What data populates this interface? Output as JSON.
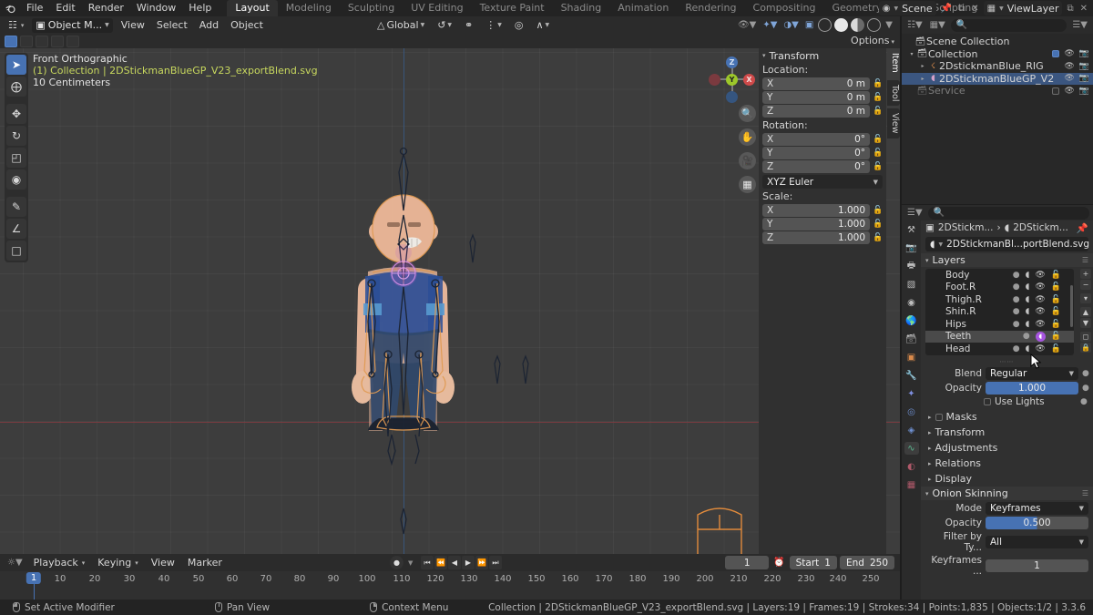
{
  "app": {
    "name": "Blender",
    "version": "3.3.6"
  },
  "topbar": {
    "logo_icon": "blender-logo-icon",
    "menus": [
      "File",
      "Edit",
      "Render",
      "Window",
      "Help"
    ],
    "workspaces": [
      {
        "label": "Layout",
        "active": true
      },
      {
        "label": "Modeling",
        "active": false
      },
      {
        "label": "Sculpting",
        "active": false
      },
      {
        "label": "UV Editing",
        "active": false
      },
      {
        "label": "Texture Paint",
        "active": false
      },
      {
        "label": "Shading",
        "active": false
      },
      {
        "label": "Animation",
        "active": false
      },
      {
        "label": "Rendering",
        "active": false
      },
      {
        "label": "Compositing",
        "active": false
      },
      {
        "label": "Geometry Nodes",
        "active": false
      },
      {
        "label": "Scripting",
        "active": false
      }
    ],
    "add_workspace_label": "+",
    "scene": {
      "icon": "scene-icon",
      "name": "Scene",
      "pin_icon": "pin-icon",
      "new_icon": "new-copy-icon",
      "unlink_icon": "x-icon"
    },
    "viewlayer": {
      "icon": "viewlayer-icon",
      "name": "ViewLayer",
      "new_icon": "new-copy-icon",
      "unlink_icon": "x-icon"
    }
  },
  "viewport_header": {
    "editor_type_icon": "editor-type-icon",
    "mode": "Object M...",
    "menus": [
      "View",
      "Select",
      "Add",
      "Object"
    ],
    "transform_orientation": "Global",
    "pivot_icon": "pivot-icon",
    "snap_icon": "magnet-icon",
    "snap_target_icon": "snap-increment-icon",
    "proportional_icon": "proportional-editing-icon",
    "falloff_icon": "smooth-falloff-icon",
    "right_icons": [
      "visibility-icon",
      "gizmo-icon",
      "overlays-icon",
      "xray-icon",
      "shading-wireframe-icon",
      "shading-solid-icon",
      "shading-material-icon",
      "shading-rendered-icon"
    ],
    "options_label": "Options"
  },
  "viewport": {
    "view_name": "Front Orthographic",
    "collection_line": "(1) Collection | 2DStickmanBlueGP_V23_exportBlend.svg",
    "grid_scale": "10 Centimeters",
    "gizmo_axes": [
      {
        "label": "Z",
        "color": "#4772b3"
      },
      {
        "label": "Y",
        "color": "#9dc82a"
      },
      {
        "label": "X",
        "color": "#cf4a4a"
      }
    ],
    "nav_icons": [
      "zoom-icon",
      "pan-hand-icon",
      "camera-icon",
      "orthographic-grid-icon"
    ],
    "tools": [
      {
        "name": "tweak-select-tool",
        "glyph": "➤",
        "active": true
      },
      {
        "name": "cursor-tool",
        "glyph": "⊕",
        "active": false
      },
      {
        "name": "move-tool",
        "glyph": "✥",
        "active": false
      },
      {
        "name": "rotate-tool",
        "glyph": "↻",
        "active": false
      },
      {
        "name": "scale-tool",
        "glyph": "◰",
        "active": false
      },
      {
        "name": "transform-tool",
        "glyph": "◉",
        "active": false
      },
      {
        "name": "annotate-tool",
        "glyph": "✎",
        "active": false
      },
      {
        "name": "measure-tool",
        "glyph": "∠",
        "active": false
      },
      {
        "name": "add-cube-tool",
        "glyph": "□",
        "active": false
      }
    ],
    "select_modes": [
      "set-select-mode",
      "extend-select-mode",
      "subtract-select-mode",
      "invert-select-mode",
      "intersect-select-mode"
    ]
  },
  "sidebar_n": {
    "tabs": [
      {
        "label": "Item",
        "active": true
      },
      {
        "label": "Tool",
        "active": false
      },
      {
        "label": "View",
        "active": false
      }
    ],
    "panel_title": "Transform",
    "location_label": "Location:",
    "location": [
      {
        "axis": "X",
        "value": "0 m"
      },
      {
        "axis": "Y",
        "value": "0 m"
      },
      {
        "axis": "Z",
        "value": "0 m"
      }
    ],
    "rotation_label": "Rotation:",
    "rotation": [
      {
        "axis": "X",
        "value": "0°"
      },
      {
        "axis": "Y",
        "value": "0°"
      },
      {
        "axis": "Z",
        "value": "0°"
      }
    ],
    "rotation_mode": "XYZ Euler",
    "scale_label": "Scale:",
    "scale": [
      {
        "axis": "X",
        "value": "1.000"
      },
      {
        "axis": "Y",
        "value": "1.000"
      },
      {
        "axis": "Z",
        "value": "1.000"
      }
    ]
  },
  "outliner": {
    "display_mode_icon": "view-layer-icon",
    "filter_icon": "filter-icon",
    "search_placeholder": "",
    "search_value": "",
    "rows": [
      {
        "label": "Scene Collection",
        "icon": "collection-icon",
        "indent": 0,
        "tri": "",
        "selected": false,
        "dim": false,
        "checkbox": null,
        "eye": false,
        "camera": false
      },
      {
        "label": "Collection",
        "icon": "collection-icon",
        "indent": 1,
        "tri": "▾",
        "selected": false,
        "dim": false,
        "checkbox": true,
        "eye": true,
        "camera": true
      },
      {
        "label": "2DstickmanBlue_RIG",
        "icon": "armature-icon",
        "indent": 2,
        "tri": "▸",
        "selected": false,
        "dim": false,
        "checkbox": null,
        "eye": true,
        "camera": true
      },
      {
        "label": "2DStickmanBlueGP_V2",
        "icon": "grease-pencil-icon",
        "indent": 2,
        "tri": "▸",
        "selected": true,
        "dim": false,
        "checkbox": null,
        "eye": true,
        "camera": true
      },
      {
        "label": "Service",
        "icon": "collection-icon",
        "indent": 1,
        "tri": "",
        "selected": false,
        "dim": true,
        "checkbox": false,
        "eye": true,
        "camera": true
      }
    ]
  },
  "properties": {
    "editor_icon": "properties-editor-icon",
    "search_placeholder": "",
    "tabs": [
      {
        "name": "tool-tab",
        "glyph": "⚒",
        "active": false
      },
      {
        "name": "render-tab",
        "glyph": "▣",
        "active": false
      },
      {
        "name": "output-tab",
        "glyph": "⎙",
        "active": false
      },
      {
        "name": "view-layer-tab",
        "glyph": "❑",
        "active": false
      },
      {
        "name": "scene-tab",
        "glyph": "◎",
        "active": false
      },
      {
        "name": "world-tab",
        "glyph": "●",
        "active": false
      },
      {
        "name": "collection-tab",
        "glyph": "□",
        "active": false
      },
      {
        "name": "object-tab",
        "glyph": "■",
        "active": false
      },
      {
        "name": "modifier-tab",
        "glyph": "ὒ7",
        "active": false
      },
      {
        "name": "effects-tab",
        "glyph": "✨",
        "active": false
      },
      {
        "name": "particles-tab",
        "glyph": "◉",
        "active": false
      },
      {
        "name": "physics-tab",
        "glyph": "◔",
        "active": false
      },
      {
        "name": "object-data-tab",
        "glyph": "∿",
        "active": true
      },
      {
        "name": "material-tab",
        "glyph": "◕",
        "active": false
      },
      {
        "name": "texture-tab",
        "glyph": "▓",
        "active": false
      }
    ],
    "breadcrumb": {
      "object_icon": "object-icon",
      "object": "2DStickm...",
      "sep": "›",
      "data_icon": "grease-pencil-data-icon",
      "data": "2DStickm...",
      "pin_icon": "pin-icon"
    },
    "id_block": {
      "icon": "grease-pencil-data-icon",
      "name": "2DStickmanBl...portBlend.svg",
      "shield_icon": "fake-user-icon"
    },
    "layers_panel": {
      "title": "Layers",
      "layers": [
        {
          "name": "Body",
          "selected": false,
          "mask": false
        },
        {
          "name": "Foot.R",
          "selected": false,
          "mask": false
        },
        {
          "name": "Thigh.R",
          "selected": false,
          "mask": false
        },
        {
          "name": "Shin.R",
          "selected": false,
          "mask": false
        },
        {
          "name": "Hips",
          "selected": false,
          "mask": false
        },
        {
          "name": "Teeth",
          "selected": true,
          "mask": false,
          "highlighted_icon": "onion-skinning-icon"
        },
        {
          "name": "Head",
          "selected": false,
          "mask": false
        }
      ],
      "side_buttons": [
        "add-layer-button",
        "remove-layer-button",
        "layer-specials-menu",
        "move-layer-up-button",
        "move-layer-down-button",
        "isolate-layer-button",
        "lock-layer-button"
      ]
    },
    "blend_label": "Blend",
    "blend_value": "Regular",
    "opacity_label": "Opacity",
    "opacity_value": "1.000",
    "use_lights_label": "Use Lights",
    "sub_panels": [
      "Masks",
      "Transform",
      "Adjustments",
      "Relations",
      "Display"
    ],
    "onion_skinning": {
      "title": "Onion Skinning",
      "mode_label": "Mode",
      "mode_value": "Keyframes",
      "opacity_label": "Opacity",
      "opacity_value": "0.500",
      "filter_label": "Filter by Ty...",
      "filter_value": "All",
      "keyframes_label": "Keyframes ...",
      "keyframes_value": "1"
    }
  },
  "timeline": {
    "editor_icon": "timeline-editor-icon",
    "menus": [
      "Playback",
      "Keying",
      "View",
      "Marker"
    ],
    "autokey_icon": "record-icon",
    "transport": [
      "jump-to-start-icon",
      "jump-to-prev-keyframe-icon",
      "play-reverse-icon",
      "play-icon",
      "jump-to-next-keyframe-icon",
      "jump-to-end-icon"
    ],
    "current_frame": "1",
    "clock_icon": "use-preview-range-icon",
    "start_label": "Start",
    "start_value": "1",
    "end_label": "End",
    "end_value": "250",
    "ticks": [
      10,
      20,
      30,
      40,
      50,
      60,
      70,
      80,
      90,
      100,
      110,
      120,
      130,
      140,
      150,
      160,
      170,
      180,
      190,
      200,
      210,
      220,
      230,
      240,
      250
    ],
    "playhead_frame": "1"
  },
  "statusbar": {
    "hints": [
      {
        "icon": "mouse-left-icon",
        "label": "Set Active Modifier"
      },
      {
        "icon": "mouse-middle-icon",
        "label": "Pan View"
      },
      {
        "icon": "mouse-right-icon",
        "label": "Context Menu"
      }
    ],
    "info": "Collection | 2DStickmanBlueGP_V23_exportBlend.svg | Layers:19 | Frames:19 | Strokes:34 | Points:1,835 | Objects:1/2 | 3.3.6"
  },
  "colors": {
    "accent_blue": "#4772b3",
    "header_bg": "#2b2b2b",
    "viewport_bg": "#3d3d3d",
    "highlight_purple": "#a855e0",
    "text_yellow": "#c8d85e",
    "skin": "#eab594",
    "shirt": "#2a4f9b"
  }
}
